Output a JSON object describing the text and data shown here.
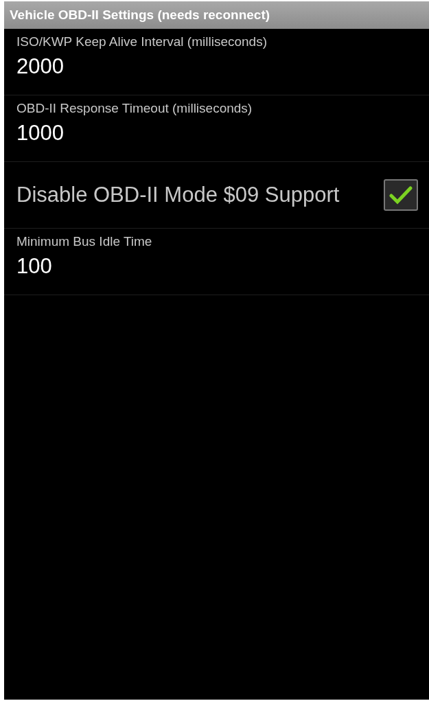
{
  "window": {
    "title": "Vehicle OBD-II Settings (needs reconnect)"
  },
  "settings": [
    {
      "kind": "value",
      "label": "ISO/KWP Keep Alive Interval (milliseconds)",
      "value": "2000"
    },
    {
      "kind": "value",
      "label": "OBD-II Response Timeout (milliseconds)",
      "value": "1000"
    },
    {
      "kind": "checkbox",
      "label": "Disable OBD-II Mode $09 Support",
      "checked": true
    },
    {
      "kind": "value",
      "label": "Minimum Bus Idle Time",
      "value": "100"
    }
  ]
}
